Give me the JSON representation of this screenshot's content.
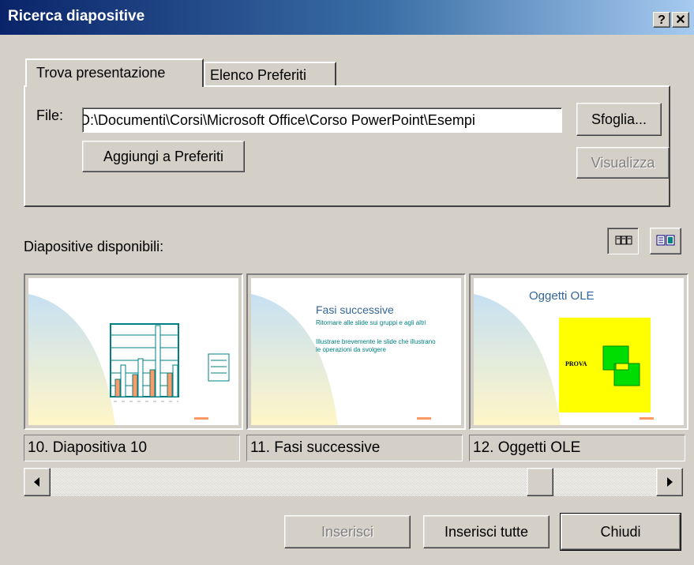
{
  "window": {
    "title": "Ricerca diapositive",
    "help_label": "?",
    "close_label": "✕"
  },
  "tabs": [
    {
      "label": "Trova presentazione",
      "active": true
    },
    {
      "label": "Elenco Preferiti",
      "active": false
    }
  ],
  "file": {
    "label": "File:",
    "value": "D:\\Documenti\\Corsi\\Microsoft Office\\Corso PowerPoint\\Esempi"
  },
  "buttons": {
    "browse": "Sfoglia...",
    "add_favorites": "Aggiungi a Preferiti",
    "view": "Visualizza",
    "insert": "Inserisci",
    "insert_all": "Inserisci tutte",
    "close": "Chiudi"
  },
  "available": {
    "label": "Diapositive disponibili:"
  },
  "slides": [
    {
      "caption": "10. Diapositiva 10"
    },
    {
      "caption": "11. Fasi successive",
      "title": "Fasi successive",
      "bullets": [
        "Ritornare alle slide sui gruppi e agli altri",
        "Illustrare brevemente le slide che illustrano le operazioni da svolgere"
      ]
    },
    {
      "caption": "12. Oggetti OLE",
      "title": "Oggetti OLE",
      "object_label": "PROVA"
    }
  ],
  "colors": {
    "title_start": "#0a246a",
    "title_end": "#a6caf0",
    "chart_teal": "#008080",
    "bar_orange": "#ff9966",
    "ole_yellow": "#ffff00",
    "ole_green": "#00dd00",
    "slide_title_blue": "#336699"
  }
}
